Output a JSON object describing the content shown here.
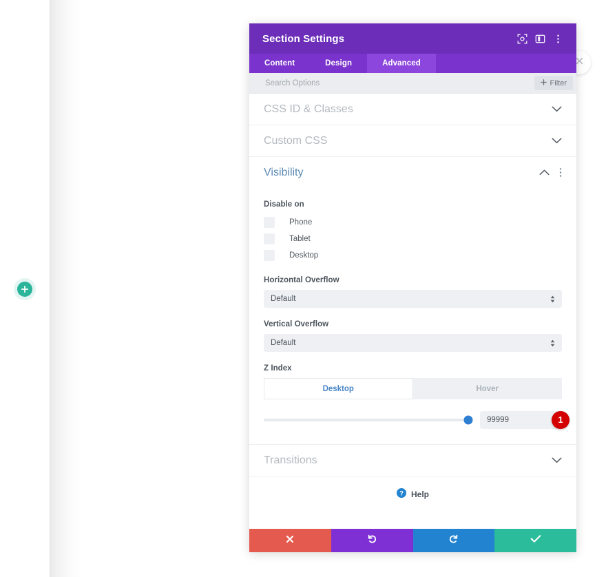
{
  "canvas": {
    "add_button_icon": "plus-icon",
    "close_button_icon": "close-icon"
  },
  "panel": {
    "title": "Section Settings",
    "header_icons": [
      {
        "name": "fullscreen-icon",
        "label": "Fullscreen"
      },
      {
        "name": "layout-icon",
        "label": "Layout"
      },
      {
        "name": "kebab-menu-icon",
        "label": "More options"
      }
    ],
    "tabs": [
      {
        "label": "Content",
        "active": false
      },
      {
        "label": "Design",
        "active": false
      },
      {
        "label": "Advanced",
        "active": true
      }
    ],
    "search": {
      "placeholder": "Search Options",
      "value": ""
    },
    "filter": {
      "label": "Filter",
      "icon": "plus-icon"
    },
    "collapsed_sections": [
      {
        "label": "CSS ID & Classes",
        "icon": "chevron-down-icon"
      },
      {
        "label": "Custom CSS",
        "icon": "chevron-down-icon"
      }
    ],
    "visibility": {
      "title": "Visibility",
      "collapse_icon": "chevron-up-icon",
      "menu_icon": "kebab-menu-icon",
      "disable_on": {
        "label": "Disable on",
        "options": [
          {
            "label": "Phone",
            "checked": false
          },
          {
            "label": "Tablet",
            "checked": false
          },
          {
            "label": "Desktop",
            "checked": false
          }
        ]
      },
      "horizontal_overflow": {
        "label": "Horizontal Overflow",
        "value": "Default"
      },
      "vertical_overflow": {
        "label": "Vertical Overflow",
        "value": "Default"
      },
      "z_index": {
        "label": "Z Index",
        "state_tabs": [
          {
            "label": "Desktop",
            "active": true
          },
          {
            "label": "Hover",
            "active": false
          }
        ],
        "value": "99999",
        "slider_percent": 100,
        "badge": "1"
      }
    },
    "transitions": {
      "label": "Transitions",
      "icon": "chevron-down-icon"
    },
    "help": {
      "label": "Help",
      "icon": "help-icon"
    },
    "footer_buttons": [
      {
        "name": "cancel-button",
        "icon": "close-x-icon"
      },
      {
        "name": "undo-button",
        "icon": "undo-icon"
      },
      {
        "name": "redo-button",
        "icon": "redo-icon"
      },
      {
        "name": "save-button",
        "icon": "check-icon"
      }
    ]
  },
  "colors": {
    "header_purple": "#6c2eb9",
    "tab_purple": "#7a33cc",
    "tab_active_purple": "#8c46dd",
    "section_title_blue": "#5b89b3",
    "slider_blue": "#2f7fd1",
    "badge_red": "#d40000",
    "cancel_red": "#e45a4f",
    "undo_purple": "#7e30d4",
    "redo_blue": "#2283d0",
    "save_teal": "#2bbc9b",
    "add_teal": "#2ab499"
  }
}
